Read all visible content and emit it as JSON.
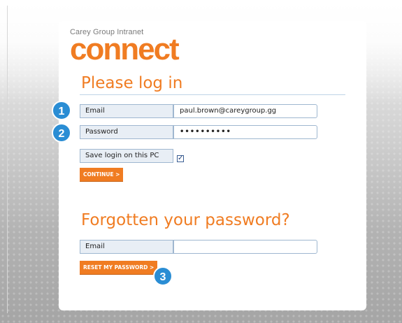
{
  "brand": {
    "name": "Carey Group Intranet",
    "logo_word": "connect"
  },
  "login": {
    "heading": "Please log in",
    "email_label": "Email",
    "email_value": "paul.brown@careygroup.gg",
    "password_label": "Password",
    "password_value": "••••••••••",
    "save_login_label": "Save login on this PC",
    "save_login_checked": true,
    "save_login_check_glyph": "✓",
    "continue_button": "CONTINUE >"
  },
  "forgot": {
    "heading": "Forgotten your password?",
    "email_label": "Email",
    "email_value": "",
    "reset_button": "RESET MY PASSWORD >"
  },
  "markers": [
    "1",
    "2",
    "3"
  ],
  "colors": {
    "accent": "#f07c22",
    "marker": "#2a8dd4",
    "field_border": "#9fb7d0",
    "label_bg": "#e8eef5"
  }
}
